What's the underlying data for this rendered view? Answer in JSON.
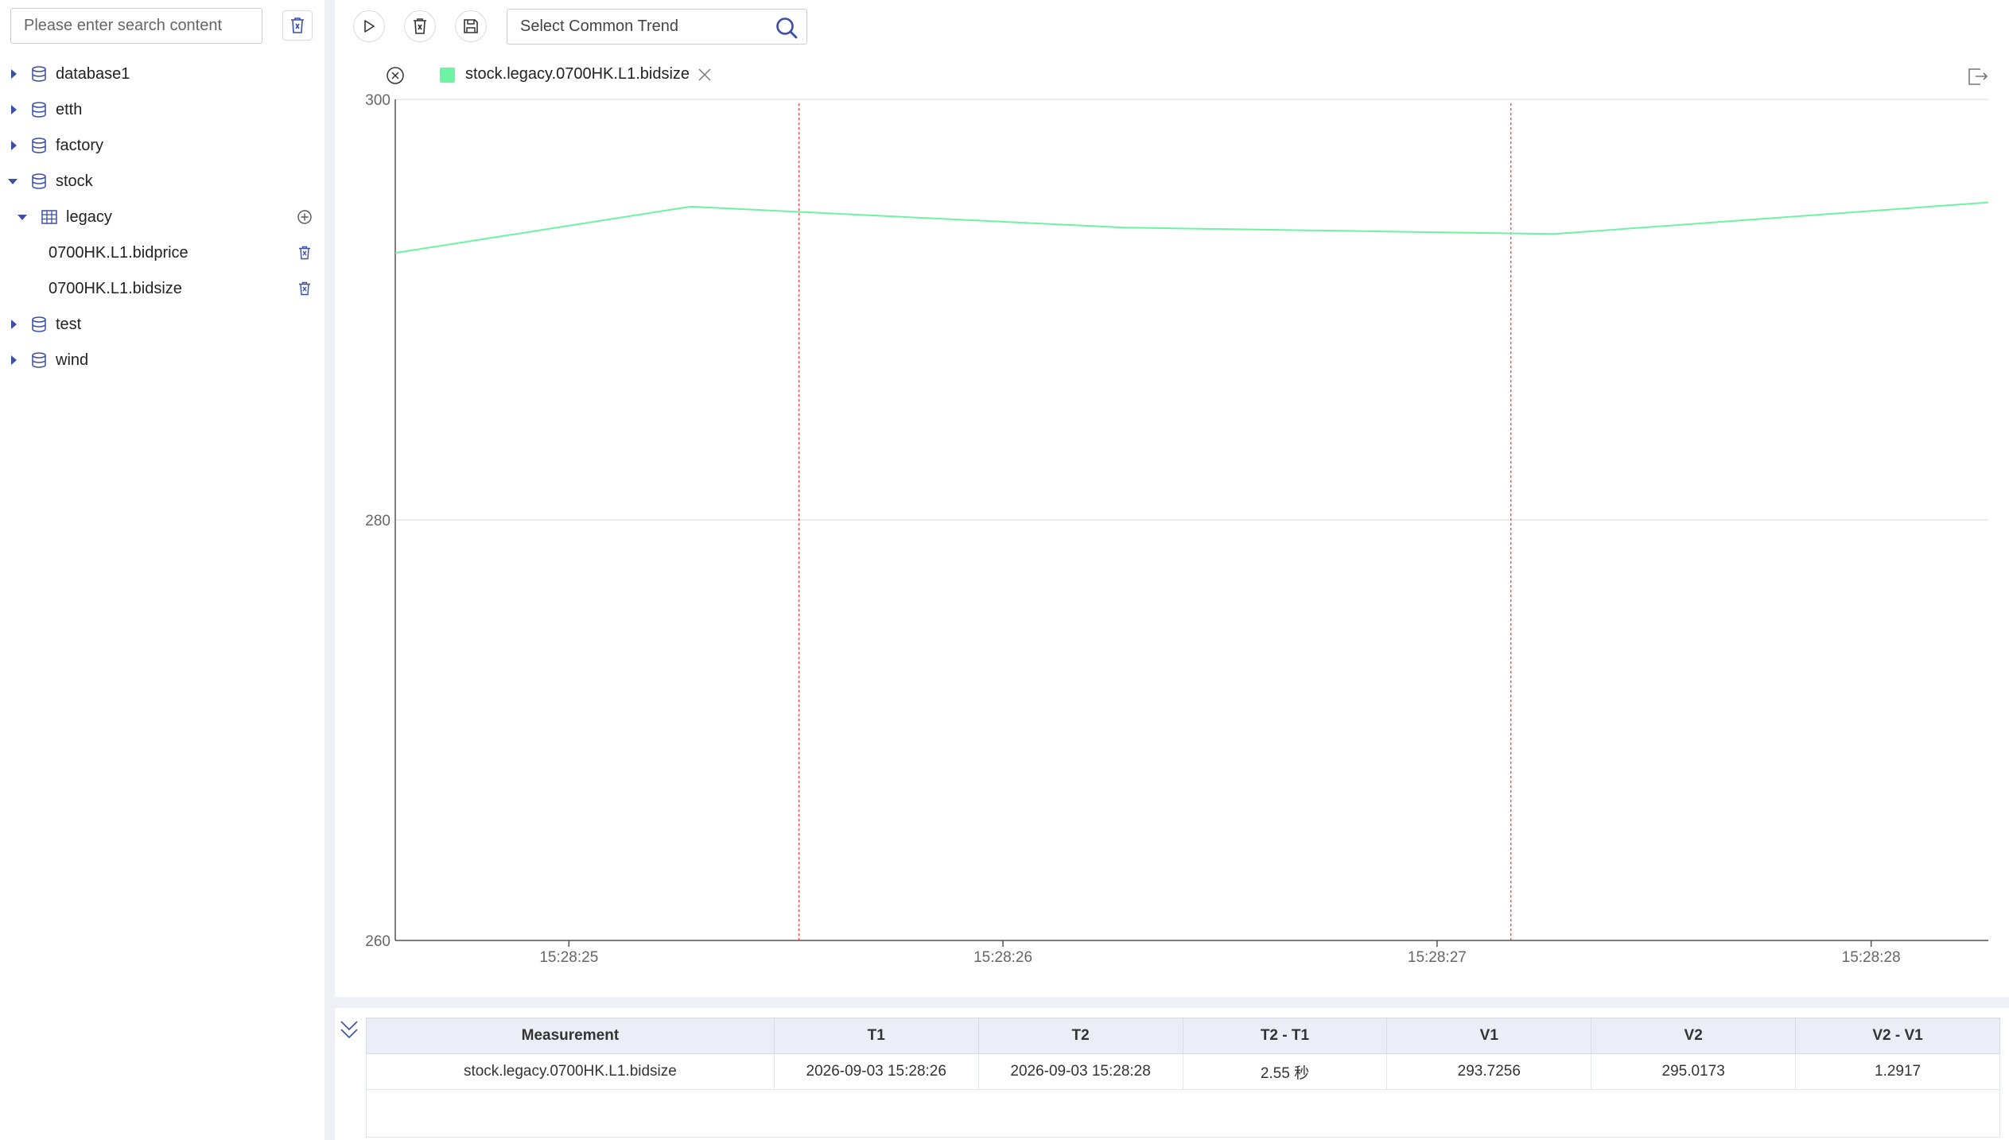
{
  "sidebar": {
    "search_placeholder": "Please enter search content",
    "tree": {
      "database1": "database1",
      "etth": "etth",
      "factory": "factory",
      "stock": "stock",
      "legacy": "legacy",
      "bidprice": "0700HK.L1.bidprice",
      "bidsize": "0700HK.L1.bidsize",
      "test": "test",
      "wind": "wind"
    }
  },
  "toolbar": {
    "trend_placeholder": "Select Common Trend"
  },
  "legend": {
    "series_label": "stock.legacy.0700HK.L1.bidsize",
    "series_color": "#6ef2a4"
  },
  "chart_data": {
    "type": "line",
    "x": [
      "15:28:24.600",
      "15:28:25.280",
      "15:28:26.280",
      "15:28:27.270",
      "15:28:28.270"
    ],
    "x_ticks": [
      "15:28:25",
      "15:28:26",
      "15:28:27",
      "15:28:28"
    ],
    "series": [
      {
        "name": "stock.legacy.0700HK.L1.bidsize",
        "values": [
          292.7,
          294.9,
          293.9,
          293.6,
          295.1
        ]
      }
    ],
    "ylim": [
      260,
      300
    ],
    "y_ticks": [
      300,
      280,
      260
    ],
    "cursors": [
      "15:28:25.530",
      "15:28:27.170"
    ],
    "grid": "horizontal",
    "series_color": "#6ef2a4",
    "cursor_color": "#e05050"
  },
  "table": {
    "headers": [
      "Measurement",
      "T1",
      "T2",
      "T2 - T1",
      "V1",
      "V2",
      "V2 - V1"
    ],
    "rows": [
      [
        "stock.legacy.0700HK.L1.bidsize",
        "2026-09-03 15:28:26",
        "2026-09-03 15:28:28",
        "2.55 秒",
        "293.7256",
        "295.0173",
        "1.2917"
      ]
    ]
  }
}
